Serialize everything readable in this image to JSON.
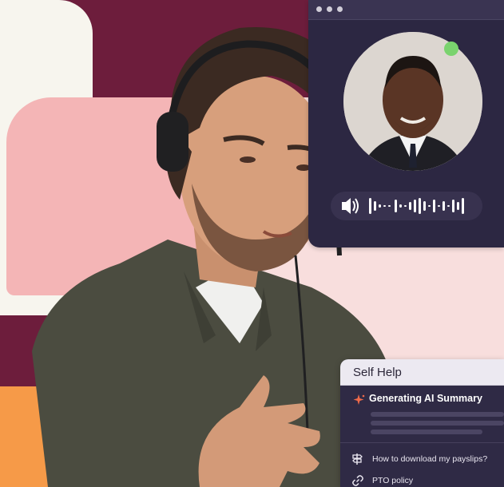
{
  "call": {
    "status": "online",
    "window_dots": 3,
    "audio_icon": "speaker-icon",
    "waveform_icon": "waveform-icon"
  },
  "self_help": {
    "title": "Self Help",
    "ai_status": "Generating AI Summary",
    "ai_icon": "sparkle-icon",
    "links": [
      {
        "label": "How to download my payslips?",
        "icon": "signpost-icon"
      },
      {
        "label": "PTO policy",
        "icon": "link-icon"
      }
    ]
  },
  "colors": {
    "maroon": "#6d1d3c",
    "cream": "#f7f5ee",
    "pink": "#f4b5b6",
    "pink_light": "#f8dedd",
    "orange": "#f69a48",
    "panel": "#2f2a45",
    "online": "#7ad36e",
    "sparkle": "#ef6a4a"
  }
}
